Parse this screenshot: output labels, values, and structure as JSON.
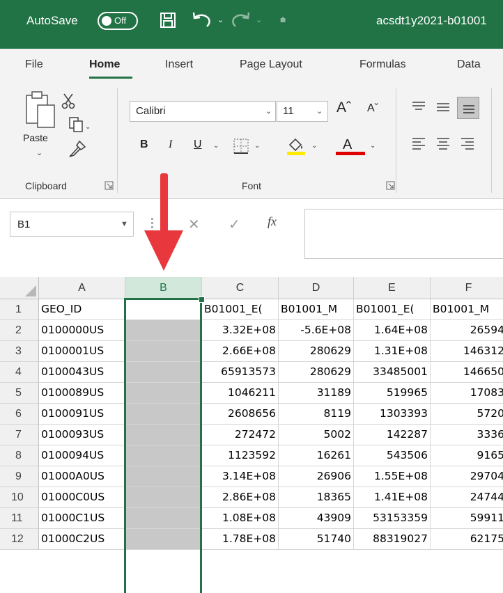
{
  "titlebar": {
    "autosave_label": "AutoSave",
    "autosave_state": "Off",
    "file_title": "acsdt1y2021-b01001"
  },
  "ribbon_tabs": [
    "File",
    "Home",
    "Insert",
    "Page Layout",
    "Formulas",
    "Data"
  ],
  "ribbon": {
    "paste_label": "Paste",
    "clipboard_group": "Clipboard",
    "font_name": "Calibri",
    "font_size": "11",
    "bold": "B",
    "italic": "I",
    "underline": "U",
    "font_group": "Font"
  },
  "formula_bar": {
    "name_box": "B1",
    "fx": "fx",
    "cancel": "✕",
    "enter": "✓",
    "content": ""
  },
  "grid": {
    "columns": [
      "A",
      "B",
      "C",
      "D",
      "E",
      "F"
    ],
    "selected_column": "B",
    "rows": [
      {
        "num": "1",
        "cells": [
          "GEO_ID",
          "",
          "B01001_E(",
          "B01001_M",
          "B01001_E(",
          "B01001_M"
        ]
      },
      {
        "num": "2",
        "cells": [
          "0100000US",
          "",
          "3.32E+08",
          "-5.6E+08",
          "1.64E+08",
          "26594"
        ]
      },
      {
        "num": "3",
        "cells": [
          "0100001US",
          "",
          "2.66E+08",
          "280629",
          "1.31E+08",
          "146312"
        ]
      },
      {
        "num": "4",
        "cells": [
          "0100043US",
          "",
          "65913573",
          "280629",
          "33485001",
          "146650"
        ]
      },
      {
        "num": "5",
        "cells": [
          "0100089US",
          "",
          "1046211",
          "31189",
          "519965",
          "17083"
        ]
      },
      {
        "num": "6",
        "cells": [
          "0100091US",
          "",
          "2608656",
          "8119",
          "1303393",
          "5720"
        ]
      },
      {
        "num": "7",
        "cells": [
          "0100093US",
          "",
          "272472",
          "5002",
          "142287",
          "3336"
        ]
      },
      {
        "num": "8",
        "cells": [
          "0100094US",
          "",
          "1123592",
          "16261",
          "543506",
          "9165"
        ]
      },
      {
        "num": "9",
        "cells": [
          "01000A0US",
          "",
          "3.14E+08",
          "26906",
          "1.55E+08",
          "29704"
        ]
      },
      {
        "num": "10",
        "cells": [
          "01000C0US",
          "",
          "2.86E+08",
          "18365",
          "1.41E+08",
          "24744"
        ]
      },
      {
        "num": "11",
        "cells": [
          "01000C1US",
          "",
          "1.08E+08",
          "43909",
          "53153359",
          "59911"
        ]
      },
      {
        "num": "12",
        "cells": [
          "01000C2US",
          "",
          "1.78E+08",
          "51740",
          "88319027",
          "62175"
        ]
      }
    ]
  },
  "colors": {
    "excel_green": "#217346",
    "arrow_red": "#e8383d",
    "selected_header": "#d2e8da",
    "blank_cell": "#c8c8c8"
  },
  "icons": [
    "save-icon",
    "undo-icon",
    "redo-icon",
    "paste-icon",
    "cut-icon",
    "copy-icon",
    "format-painter-icon",
    "border-icon",
    "fill-color-icon",
    "font-color-icon",
    "align-icon",
    "arrow-down-icon"
  ]
}
